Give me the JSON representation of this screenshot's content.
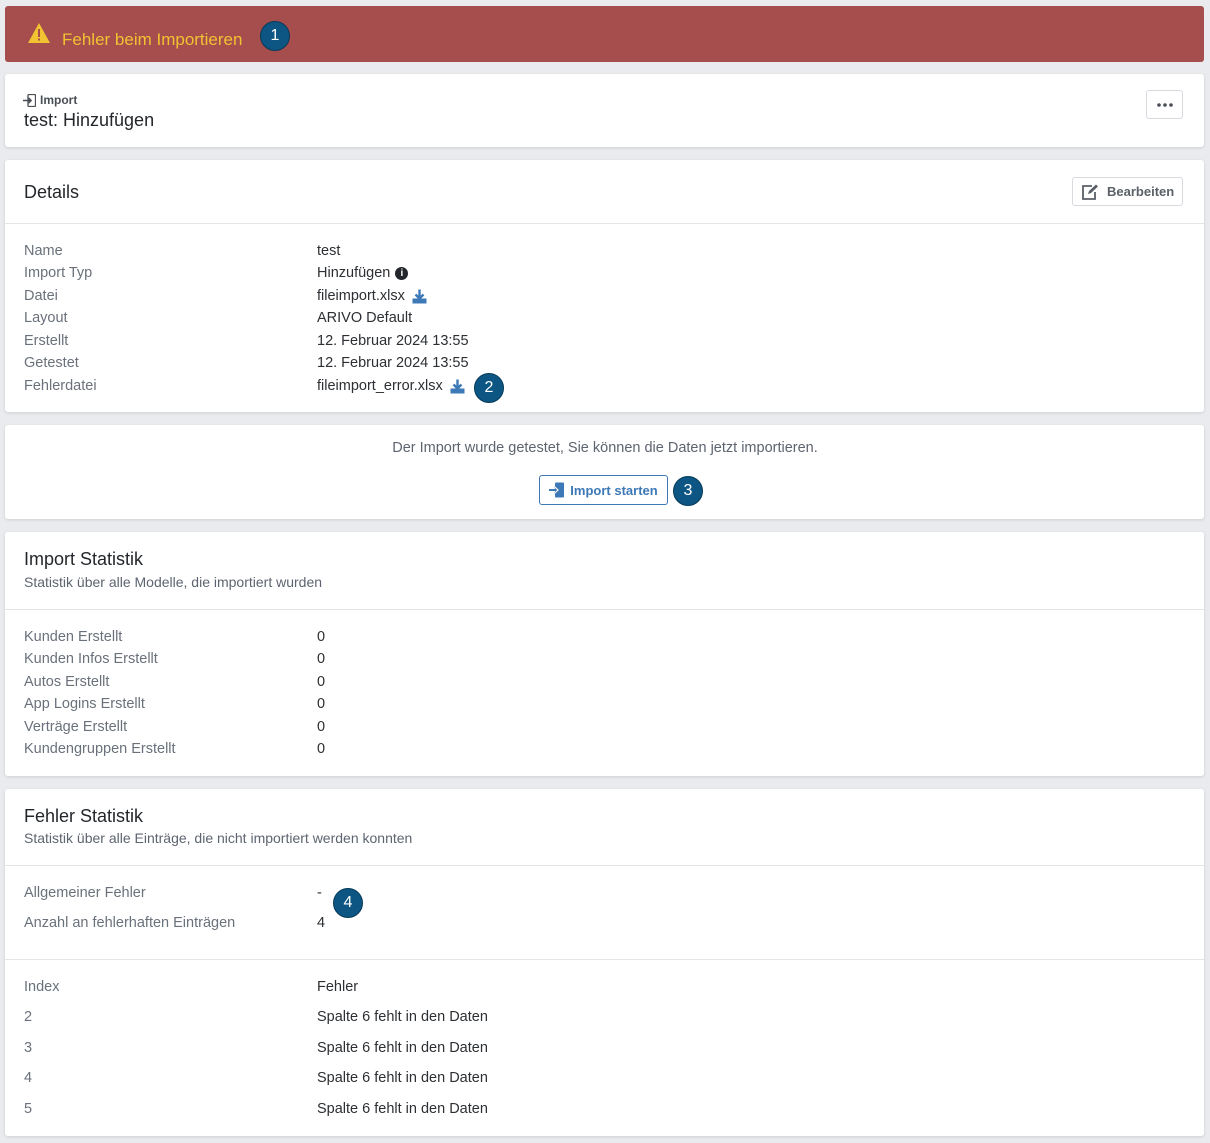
{
  "alert": {
    "text": "Fehler beim Importieren",
    "color": "#a64d4d",
    "text_color": "#f1c232"
  },
  "callouts": [
    "1",
    "2",
    "3",
    "4"
  ],
  "header": {
    "kicker": "Import",
    "title": "test: Hinzufügen",
    "more_icon": "ellipsis-icon"
  },
  "details": {
    "title": "Details",
    "edit_label": "Bearbeiten",
    "rows": [
      {
        "label": "Name",
        "value": "test"
      },
      {
        "label": "Import Typ",
        "value": "Hinzufügen"
      },
      {
        "label": "Datei",
        "value": "fileimport.xlsx"
      },
      {
        "label": "Layout",
        "value": "ARIVO Default"
      },
      {
        "label": "Erstellt",
        "value": "12. Februar 2024 13:55"
      },
      {
        "label": "Getestet",
        "value": "12. Februar 2024 13:55"
      },
      {
        "label": "Fehlerdatei",
        "value": "fileimport_error.xlsx"
      }
    ]
  },
  "action": {
    "hint": "Der Import wurde getestet, Sie können die Daten jetzt importieren.",
    "button_label": "Import starten",
    "accent": "#3d79b7"
  },
  "import_stats": {
    "title": "Import Statistik",
    "subtitle": "Statistik über alle Modelle, die importiert wurden",
    "rows": [
      {
        "label": "Kunden Erstellt",
        "value": "0"
      },
      {
        "label": "Kunden Infos Erstellt",
        "value": "0"
      },
      {
        "label": "Autos Erstellt",
        "value": "0"
      },
      {
        "label": "App Logins Erstellt",
        "value": "0"
      },
      {
        "label": "Verträge Erstellt",
        "value": "0"
      },
      {
        "label": "Kundengruppen Erstellt",
        "value": "0"
      }
    ]
  },
  "error_stats": {
    "title": "Fehler Statistik",
    "subtitle": "Statistik über alle Einträge, die nicht importiert werden konnten",
    "rows": [
      {
        "label": "Allgemeiner Fehler",
        "value": "-"
      },
      {
        "label": "Anzahl an fehlerhaften Einträgen",
        "value": "4"
      }
    ],
    "table": {
      "headers": [
        "Index",
        "Fehler"
      ],
      "rows": [
        [
          "2",
          "Spalte 6 fehlt in den Daten"
        ],
        [
          "3",
          "Spalte 6 fehlt in den Daten"
        ],
        [
          "4",
          "Spalte 6 fehlt in den Daten"
        ],
        [
          "5",
          "Spalte 6 fehlt in den Daten"
        ]
      ]
    }
  }
}
